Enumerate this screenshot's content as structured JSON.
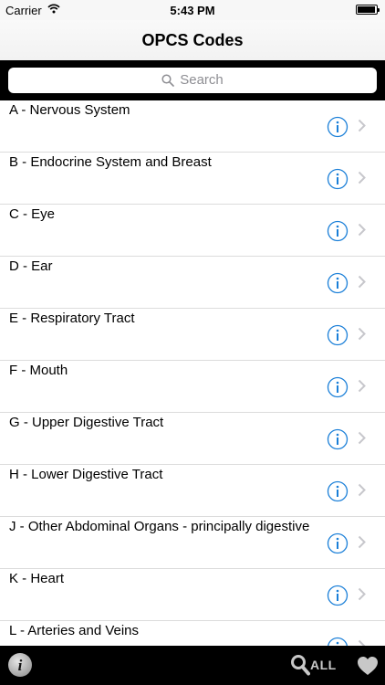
{
  "status_bar": {
    "carrier": "Carrier",
    "time": "5:43 PM"
  },
  "nav": {
    "title": "OPCS Codes"
  },
  "search": {
    "placeholder": "Search"
  },
  "list": {
    "items": [
      {
        "label": "A - Nervous System"
      },
      {
        "label": "B - Endocrine System and Breast"
      },
      {
        "label": "C - Eye"
      },
      {
        "label": "D - Ear"
      },
      {
        "label": "E - Respiratory Tract"
      },
      {
        "label": "F - Mouth"
      },
      {
        "label": "G - Upper Digestive Tract"
      },
      {
        "label": "H - Lower Digestive Tract"
      },
      {
        "label": "J - Other Abdominal Organs - principally digestive"
      },
      {
        "label": "K - Heart"
      },
      {
        "label": "L - Arteries and Veins"
      }
    ]
  },
  "bottom_bar": {
    "search_all_label": "ALL"
  },
  "colors": {
    "accent": "#1a7fd8",
    "bar_background": "#000000"
  }
}
